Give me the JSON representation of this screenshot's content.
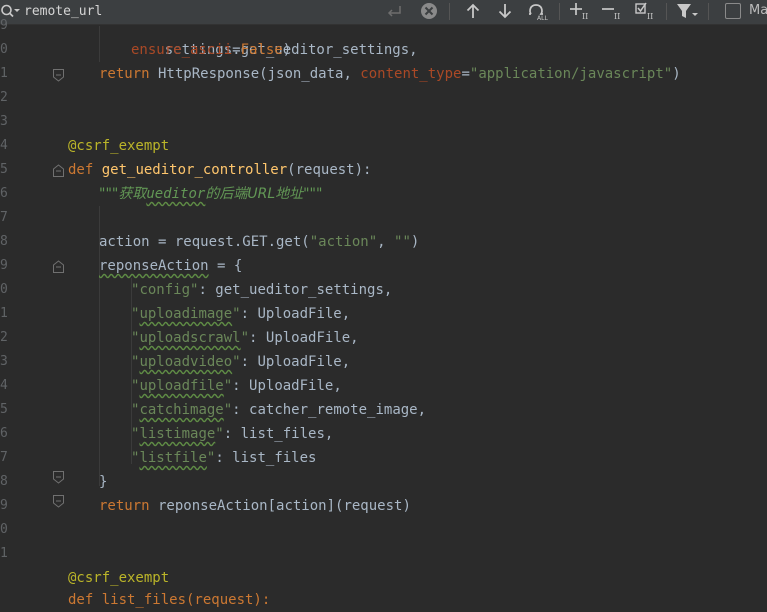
{
  "toolbar": {
    "search_value": "remote_url",
    "match_case_label": "Ma"
  },
  "gutter": {
    "line_numbers": [
      "9",
      "0",
      "1",
      "2",
      "3",
      "4",
      "5",
      "6",
      "7",
      "8",
      "9",
      "0",
      "1",
      "2",
      "3",
      "4",
      "5",
      "6",
      "7",
      "8",
      "9",
      "0",
      "1"
    ]
  },
  "code": {
    "l0": "settings.get_ueditor_settings,",
    "l1_kw": "ensure_ascii",
    "l1_eq": "=",
    "l1_val": "False",
    "l1_end": ")",
    "l2_kw": "return",
    "l2_a": " HttpResponse(json_data, ",
    "l2_p": "content_type",
    "l2_eq": "=",
    "l2_s": "\"application/javascript\"",
    "l2_end": ")",
    "l5": "@csrf_exempt",
    "l6_kw": "def",
    "l6_fn": "get_ueditor_controller",
    "l6_end": "(request):",
    "l7_a": "\"\"\"获取",
    "l7_b": "ueditor",
    "l7_c": "的后端URL地址\"\"\"",
    "l9_a": "action = request.GET.get(",
    "l9_s1": "\"action\"",
    "l9_b": ", ",
    "l9_s2": "\"\"",
    "l9_c": ")",
    "l10_var": "reponseAction",
    "l10_end": " = {",
    "entries": [
      {
        "q1": "\"",
        "key": "config",
        "q2": "\"",
        "typo": false,
        "val": ": get_ueditor_settings,"
      },
      {
        "q1": "\"",
        "key": "uploadimage",
        "q2": "\"",
        "typo": true,
        "val": ": UploadFile,"
      },
      {
        "q1": "\"",
        "key": "uploadscrawl",
        "q2": "\"",
        "typo": true,
        "val": ": UploadFile,"
      },
      {
        "q1": "\"",
        "key": "uploadvideo",
        "q2": "\"",
        "typo": true,
        "val": ": UploadFile,"
      },
      {
        "q1": "\"",
        "key": "uploadfile",
        "q2": "\"",
        "typo": true,
        "val": ": UploadFile,"
      },
      {
        "q1": "\"",
        "key": "catchimage",
        "q2": "\"",
        "typo": true,
        "val": ": catcher_remote_image,"
      },
      {
        "q1": "\"",
        "key": "listimage",
        "q2": "\"",
        "typo": true,
        "val": ": list_files,"
      },
      {
        "q1": "\"",
        "key": "listfile",
        "q2": "\"",
        "typo": true,
        "val": ": list_files"
      }
    ],
    "l19": "}",
    "l20_kw": "return",
    "l20_rest": " reponseAction[action](request)",
    "l23": "@csrf_exempt",
    "l24": "def list_files(request):"
  }
}
